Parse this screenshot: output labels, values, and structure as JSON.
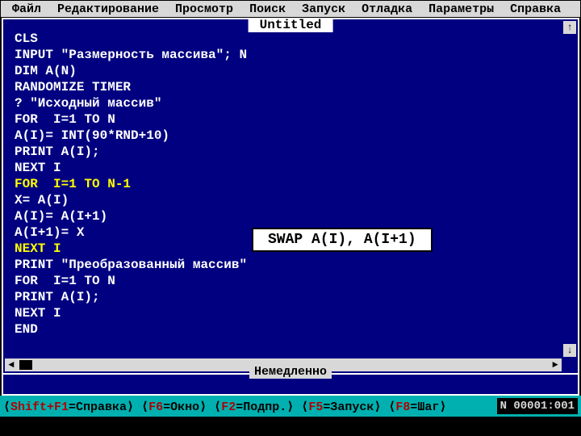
{
  "menu": {
    "file": "Файл",
    "edit": "Редактирование",
    "view": "Просмотр",
    "search": "Поиск",
    "run": "Запуск",
    "debug": "Отладка",
    "options": "Параметры",
    "help": "Справка"
  },
  "title": "Untitled",
  "code_lines": [
    "CLS",
    "INPUT \"Размерность массива\"; N",
    "DIM A(N)",
    "RANDOMIZE TIMER",
    "? \"Исходный массив\"",
    "FOR  I=1 TO N",
    "A(I)= INT(90*RND+10)",
    "PRINT A(I);",
    "NEXT I",
    "FOR  I=1 TO N-1",
    "X= A(I)",
    "A(I)= A(I+1)",
    "A(I+1)= X",
    "NEXT I",
    "PRINT \"Преобразованный массив\"",
    "FOR  I=1 TO N",
    "PRINT A(I);",
    "NEXT I",
    "END"
  ],
  "highlight_indices": [
    9,
    13
  ],
  "annotation": "SWAP A(I), A(I+1)",
  "immediate_label": "Немедленно",
  "status": {
    "hints_html": "⟨<span class='akey'>Shift+F1</span>=Справка⟩ ⟨<span class='akey'>F6</span>=Окно⟩ ⟨<span class='akey'>F2</span>=Подпр.⟩ ⟨<span class='akey'>F5</span>=Запуск⟩ ⟨<span class='akey'>F8</span>=Шаг⟩",
    "pos": "N  00001:001"
  },
  "colors": {
    "editor_bg": "#000080",
    "menubar_bg": "#d8d8d8",
    "status_bg": "#00b0b0",
    "highlight_fg": "#ffff00"
  }
}
